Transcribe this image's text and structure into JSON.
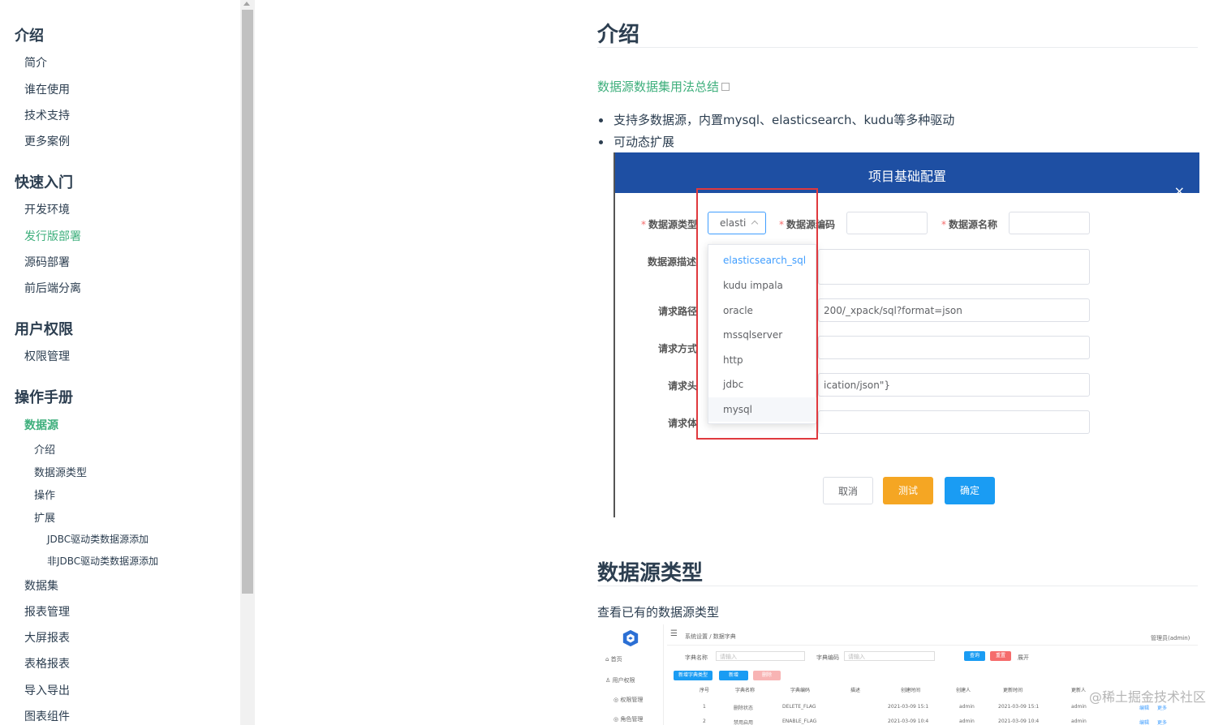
{
  "sidebar": {
    "groups": [
      {
        "label": "介绍",
        "items": [
          "简介",
          "谁在使用",
          "技术支持",
          "更多案例"
        ]
      },
      {
        "label": "快速入门",
        "items": [
          "开发环境",
          "发行版部署",
          "源码部署",
          "前后端分离"
        ]
      },
      {
        "label": "用户权限",
        "items": [
          "权限管理"
        ]
      },
      {
        "label": "操作手册",
        "items": [
          "数据源",
          "介绍",
          "数据源类型",
          "操作",
          "扩展",
          "JDBC驱动类数据源添加",
          "非JDBC驱动类数据源添加",
          "数据集",
          "报表管理",
          "大屏报表",
          "表格报表",
          "导入导出",
          "图表组件"
        ]
      }
    ]
  },
  "main": {
    "section1_title": "介绍",
    "link_text": "数据源数据集用法总结",
    "bullets": [
      "支持多数据源，内置mysql、elasticsearch、kudu等多种驱动",
      "可动态扩展"
    ],
    "section2_title": "数据源类型",
    "section2_para": "查看已有的数据源类型"
  },
  "dialog": {
    "title": "项目基础配置",
    "close": "×",
    "labels": {
      "source_type": "数据源类型",
      "source_code": "数据源编码",
      "source_name": "数据源名称",
      "source_desc": "数据源描述",
      "req_path": "请求路径",
      "req_method": "请求方式",
      "req_header": "请求头",
      "req_body": "请求体"
    },
    "select_value": "elasti",
    "path_value": "200/_xpack/sql?format=json",
    "header_value": "ication/json\"}",
    "dropdown_options": [
      "elasticsearch_sql",
      "kudu impala",
      "oracle",
      "mssqlserver",
      "http",
      "jdbc",
      "mysql"
    ],
    "buttons": {
      "cancel": "取消",
      "test": "测试",
      "ok": "确定"
    }
  },
  "screenshot2": {
    "breadcrumb": "系统设置 / 数据字典",
    "user": "管理员(admin)",
    "side_items": [
      "首页",
      "用户权限",
      "权限管理",
      "角色管理"
    ],
    "search_labels": [
      "字典名称",
      "字典编码"
    ],
    "placeholder": "请输入",
    "search_buttons": [
      "查询",
      "重置"
    ],
    "expand": "展开",
    "action_buttons": [
      "新增字典类型",
      "新增",
      "删除"
    ],
    "columns": [
      "序号",
      "字典名称",
      "字典编码",
      "描述",
      "创建时间",
      "创建人",
      "更新时间",
      "更新人"
    ],
    "rows": [
      [
        "1",
        "删除状态",
        "DELETE_FLAG",
        "",
        "2021-03-09 15:1",
        "admin",
        "2021-03-09 15:1",
        "admin"
      ],
      [
        "2",
        "禁用启用",
        "ENABLE_FLAG",
        "",
        "2021-03-09 10:4",
        "admin",
        "2021-03-09 10:4",
        "admin"
      ]
    ],
    "row_actions": [
      "编辑",
      "更多"
    ]
  },
  "watermark": "@稀土掘金技术社区",
  "colors": {
    "accent": "#3eaf7c",
    "dialog_header": "#1e4fa3",
    "primary": "#409eff",
    "warning": "#f5a623",
    "highlight_box": "#e0393e"
  }
}
